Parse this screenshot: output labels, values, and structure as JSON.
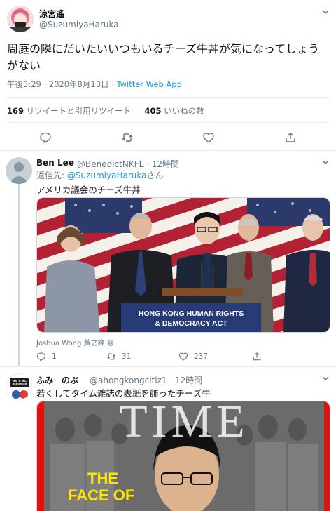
{
  "main_tweet": {
    "display_name": "涼宮遙",
    "handle": "@SuzumiyaHaruka",
    "text": "周庭の隣にだいたいいつもいるチーズ牛丼が気になってしょうがない",
    "time": "午後3:29 · 2020年8月13日 · ",
    "source": "Twitter Web App",
    "retweets_count": "169",
    "retweets_label": " リツイートと引用リツイート",
    "likes_count": "405",
    "likes_label": " いいねの数"
  },
  "replies": [
    {
      "display_name": "Ben Lee",
      "handle": "@BenedictNKFL · 12時間",
      "replying_to_prefix": "返信先: ",
      "replying_to": "@SuzumiyaHaruka",
      "replying_to_suffix": "さん",
      "text": "アメリカ議会のチーズ牛丼",
      "podium_sign_line1": "HONG KONG HUMAN RIGHTS",
      "podium_sign_line2": "& DEMOCRACY ACT",
      "media_caption": "Joshua Wong 黃之鋒 😷",
      "replies_count": "1",
      "retweets_count": "31",
      "likes_count": "237"
    },
    {
      "display_name": "ふみ　のぶ",
      "handle": "@ahongkongcitiz1 · 12時間",
      "text": "若くしてタイム雑誌の表紙を飾ったチーズ牛",
      "magazine_title": "TIME",
      "cover_line1": "THE",
      "cover_line2": "FACE OF",
      "avatar_text": "MR. & MS. REPORTER"
    }
  ],
  "colors": {
    "accent": "#1b95e0",
    "secondary_text": "#657786",
    "border": "#e6ecf0",
    "time_red": "#e3120b"
  }
}
